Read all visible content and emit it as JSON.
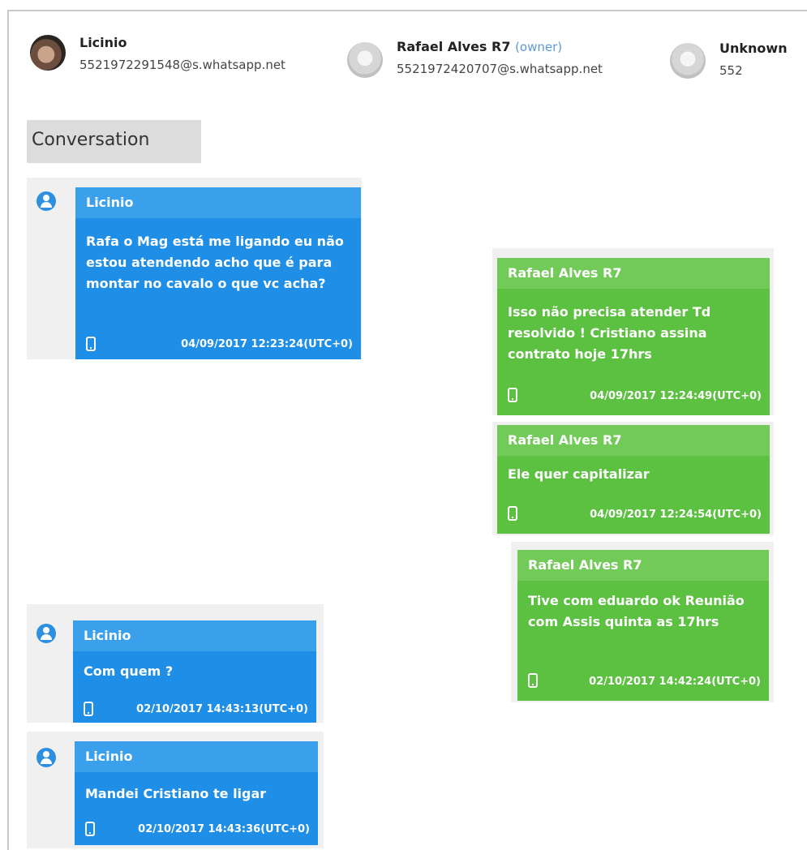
{
  "participants": [
    {
      "name": "Licinio",
      "id": "5521972291548@s.whatsapp.net",
      "owner_label": "",
      "avatar": "photo-avatar"
    },
    {
      "name": "Rafael Alves R7",
      "id": "5521972420707@s.whatsapp.net",
      "owner_label": "(owner)",
      "avatar": "generic-avatar"
    },
    {
      "name": "Unknown",
      "id": "552",
      "owner_label": "",
      "avatar": "generic-avatar"
    }
  ],
  "section_title": "Conversation",
  "messages": [
    {
      "sender": "Licinio",
      "text": "Rafa o Mag está me ligando eu não estou atendendo acho que é para montar no cavalo o que vc acha?",
      "time": "04/09/2017 12:23:24(UTC+0)",
      "direction": "incoming"
    },
    {
      "sender": "Rafael Alves R7",
      "text": "Isso  não precisa atender Td resolvido ! Cristiano assina contrato hoje 17hrs",
      "time": "04/09/2017 12:24:49(UTC+0)",
      "direction": "outgoing"
    },
    {
      "sender": "Rafael Alves R7",
      "text": "Ele quer capitalizar",
      "time": "04/09/2017 12:24:54(UTC+0)",
      "direction": "outgoing"
    },
    {
      "sender": "Rafael Alves R7",
      "text": "Tive com eduardo ok Reunião com Assis quinta as 17hrs",
      "time": "02/10/2017 14:42:24(UTC+0)",
      "direction": "outgoing"
    },
    {
      "sender": "Licinio",
      "text": "Com quem ?",
      "time": "02/10/2017 14:43:13(UTC+0)",
      "direction": "incoming"
    },
    {
      "sender": "Licinio",
      "text": "Mandei Cristiano te ligar",
      "time": "02/10/2017 14:43:36(UTC+0)",
      "direction": "incoming"
    }
  ],
  "colors": {
    "incoming": "#1f8ee6",
    "outgoing": "#5cc041",
    "owner_label": "#5b9bd5"
  },
  "icons": {
    "device": "phone-icon",
    "sender": "user-icon"
  }
}
